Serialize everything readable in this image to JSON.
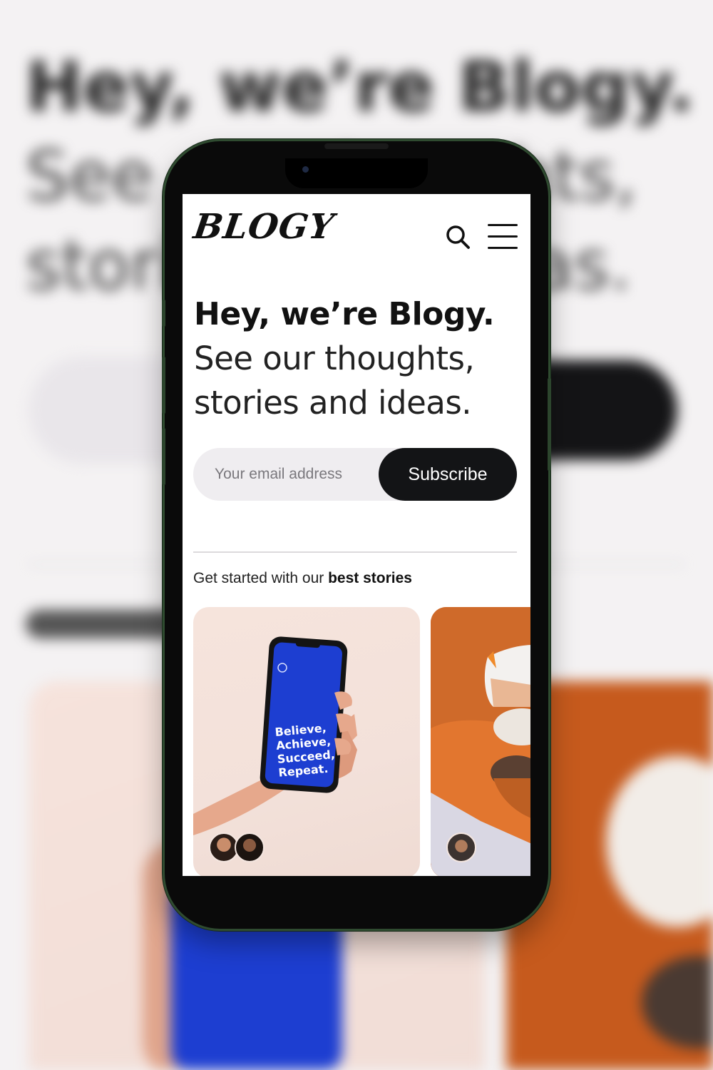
{
  "background_blur": {
    "heading_bold": "Hey, we’re Blogy.",
    "heading_light_1": "See our thoughts,",
    "heading_light_2": "stories and ideas."
  },
  "app": {
    "logo_text": "BLOGY",
    "header_icons": [
      "search-icon",
      "menu-icon"
    ]
  },
  "hero": {
    "title_bold": "Hey, we’re Blogy.",
    "title_line_2": "See our thoughts,",
    "title_line_3": "stories and ideas."
  },
  "subscribe": {
    "email_placeholder": "Your email address",
    "email_value": "",
    "button_label": "Subscribe"
  },
  "stories": {
    "section_prefix": "Get started with our ",
    "section_bold": "best stories",
    "cards": [
      {
        "image_text": [
          "Believe,",
          "Achieve,",
          "Succeed,",
          "Repeat."
        ],
        "author_avatars": 2
      },
      {
        "author_avatars": 1
      }
    ]
  },
  "colors": {
    "accent_dark": "#131416",
    "phone_frame": "#2f4b30",
    "card_blue": "#1d3ed1",
    "card_orange": "#d06a2c"
  }
}
